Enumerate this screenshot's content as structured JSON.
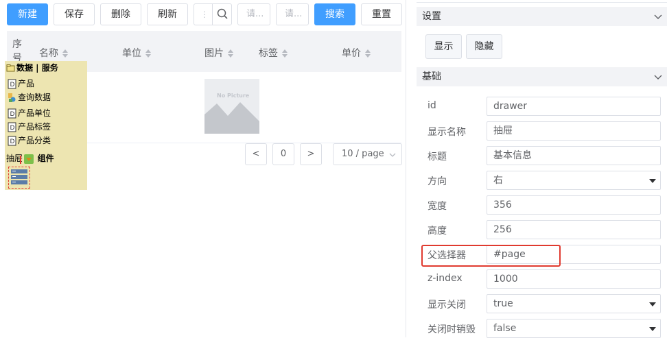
{
  "toolbar": {
    "new_label": "新建",
    "save_label": "保存",
    "delete_label": "删除",
    "refresh_label": "刷新",
    "search_placeholder_1": "请...",
    "search_placeholder_2": "请...",
    "search_label": "搜索",
    "reset_label": "重置"
  },
  "grid": {
    "columns": [
      "序号",
      "名称",
      "单位",
      "图片",
      "标签",
      "单价"
    ],
    "no_picture_text": "No Picture"
  },
  "pagination": {
    "prev": "<",
    "page": "0",
    "next": ">",
    "page_size": "10 / page"
  },
  "tree": {
    "header": "数据 | 服务",
    "items": [
      "产品",
      "查询数据",
      "产品单位",
      "产品标签",
      "产品分类"
    ],
    "drawer_label": "抽屉",
    "component_label": "组件"
  },
  "settings": {
    "title": "设置",
    "show_label": "显示",
    "hide_label": "隐藏"
  },
  "basic": {
    "title": "基础",
    "rows": [
      {
        "label": "id",
        "value": "drawer",
        "type": "text"
      },
      {
        "label": "显示名称",
        "value": "抽屉",
        "type": "text"
      },
      {
        "label": "标题",
        "value": "基本信息",
        "type": "text"
      },
      {
        "label": "方向",
        "value": "右",
        "type": "select"
      },
      {
        "label": "宽度",
        "value": "356",
        "type": "text"
      },
      {
        "label": "高度",
        "value": "256",
        "type": "text"
      },
      {
        "label": "父选择器",
        "value": "#page",
        "type": "text"
      },
      {
        "label": "z-index",
        "value": "1000",
        "type": "text"
      },
      {
        "label": "显示关闭",
        "value": "true",
        "type": "select"
      },
      {
        "label": "关闭时销毁",
        "value": "false",
        "type": "select"
      }
    ]
  },
  "colors": {
    "primary": "#409eff",
    "highlight": "#e03a2f",
    "tree_bg": "#ede5b1"
  }
}
